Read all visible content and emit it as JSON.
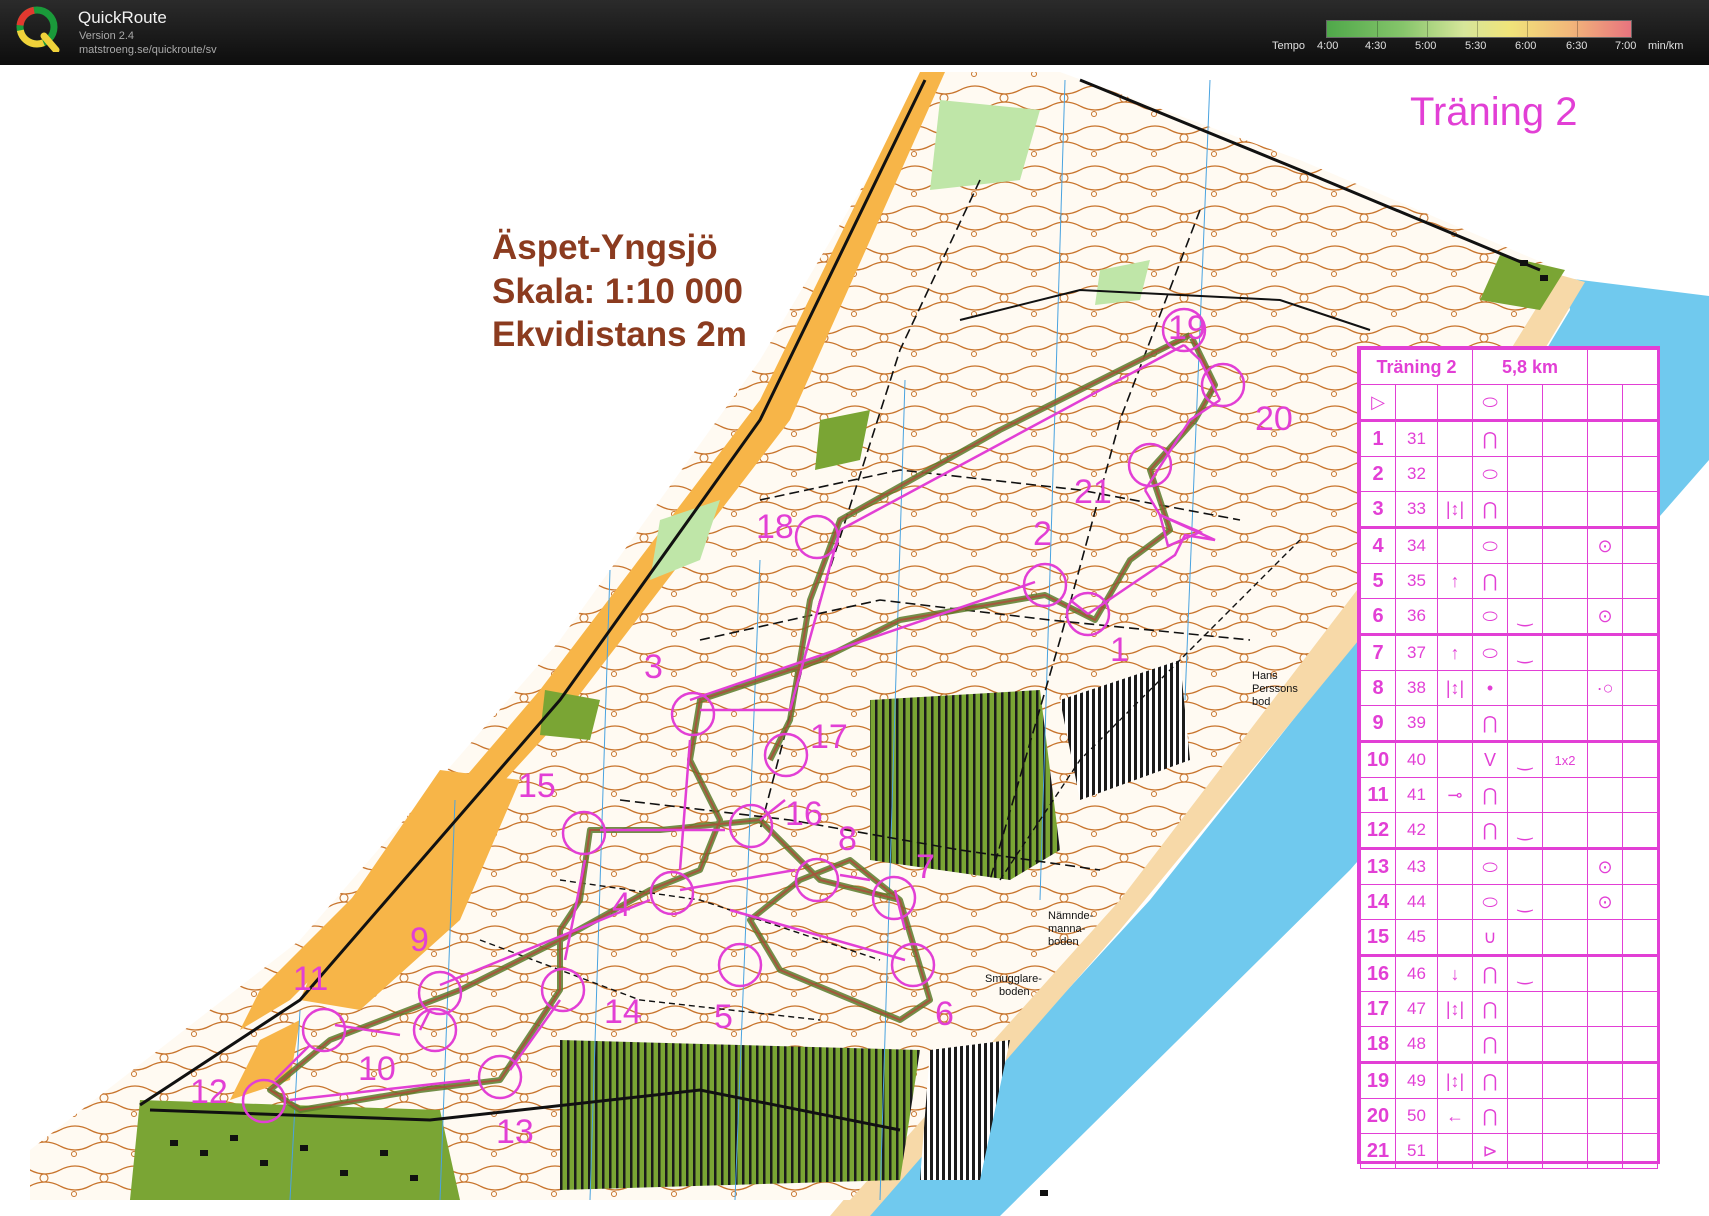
{
  "app": {
    "name": "QuickRoute",
    "version": "Version 2.4",
    "url": "matstroeng.se/quickroute/sv"
  },
  "pace_scale": {
    "label": "Tempo",
    "ticks": [
      "4:00",
      "4:30",
      "5:00",
      "5:30",
      "6:00",
      "6:30",
      "7:00"
    ],
    "unit": "min/km",
    "colors": [
      "#4fa84a",
      "#86c56b",
      "#d6e59a",
      "#f0e47a",
      "#f2b77a",
      "#e8747e"
    ]
  },
  "map": {
    "title_lines": [
      "Äspet-Yngsjö",
      "Skala: 1:10 000",
      "Ekvidistans 2m"
    ],
    "course_title": "Träning 2",
    "colors": {
      "course": "#e23fd5",
      "title": "#8b3b1f",
      "open_land": "#f7b548",
      "forest_green": "#6e8f22",
      "water": "#70c9ee",
      "contour": "#c8742c"
    },
    "controls": [
      {
        "n": "1"
      },
      {
        "n": "2"
      },
      {
        "n": "3"
      },
      {
        "n": "4"
      },
      {
        "n": "5"
      },
      {
        "n": "6"
      },
      {
        "n": "7"
      },
      {
        "n": "8"
      },
      {
        "n": "9"
      },
      {
        "n": "10"
      },
      {
        "n": "11"
      },
      {
        "n": "12"
      },
      {
        "n": "13"
      },
      {
        "n": "14"
      },
      {
        "n": "15"
      },
      {
        "n": "16"
      },
      {
        "n": "17"
      },
      {
        "n": "18"
      },
      {
        "n": "19"
      },
      {
        "n": "20"
      },
      {
        "n": "21"
      }
    ],
    "place_labels": {
      "hans": [
        "Hans",
        "Perssons",
        "bod"
      ],
      "namnde": [
        "Nämnde-",
        "manna-",
        "boden"
      ],
      "smugglare": [
        "Smugglare-",
        "boden"
      ]
    }
  },
  "description_sheet": {
    "header": {
      "course": "Träning 2",
      "length": "5,8 km"
    },
    "start_symbol": "▷",
    "start_feature": "⬭",
    "rows": [
      {
        "n": "1",
        "code": "31",
        "c": "",
        "d": "⋂",
        "e": "",
        "f": "",
        "g": ""
      },
      {
        "n": "2",
        "code": "32",
        "c": "",
        "d": "⬭",
        "e": "",
        "f": "",
        "g": ""
      },
      {
        "n": "3",
        "code": "33",
        "c": "|↕|",
        "d": "⋂",
        "e": "",
        "f": "",
        "g": ""
      },
      {
        "n": "4",
        "code": "34",
        "c": "",
        "d": "⬭",
        "e": "",
        "f": "",
        "g": "⊙"
      },
      {
        "n": "5",
        "code": "35",
        "c": "↑",
        "d": "⋂",
        "e": "",
        "f": "",
        "g": ""
      },
      {
        "n": "6",
        "code": "36",
        "c": "",
        "d": "⬭",
        "e": "‿",
        "f": "",
        "g": "⊙"
      },
      {
        "n": "7",
        "code": "37",
        "c": "↑",
        "d": "⬭",
        "e": "‿",
        "f": "",
        "g": ""
      },
      {
        "n": "8",
        "code": "38",
        "c": "|↕|",
        "d": "•",
        "e": "",
        "f": "",
        "g": "·○"
      },
      {
        "n": "9",
        "code": "39",
        "c": "",
        "d": "⋂",
        "e": "",
        "f": "",
        "g": ""
      },
      {
        "n": "10",
        "code": "40",
        "c": "",
        "d": "V",
        "e": "‿",
        "f": "1x2",
        "g": ""
      },
      {
        "n": "11",
        "code": "41",
        "c": "⊸",
        "d": "⋂",
        "e": "",
        "f": "",
        "g": ""
      },
      {
        "n": "12",
        "code": "42",
        "c": "",
        "d": "⋂",
        "e": "‿",
        "f": "",
        "g": ""
      },
      {
        "n": "13",
        "code": "43",
        "c": "",
        "d": "⬭",
        "e": "",
        "f": "",
        "g": "⊙"
      },
      {
        "n": "14",
        "code": "44",
        "c": "",
        "d": "⬭",
        "e": "‿",
        "f": "",
        "g": "⊙"
      },
      {
        "n": "15",
        "code": "45",
        "c": "",
        "d": "∪",
        "e": "",
        "f": "",
        "g": ""
      },
      {
        "n": "16",
        "code": "46",
        "c": "↓",
        "d": "⋂",
        "e": "‿",
        "f": "",
        "g": ""
      },
      {
        "n": "17",
        "code": "47",
        "c": "|↕|",
        "d": "⋂",
        "e": "",
        "f": "",
        "g": ""
      },
      {
        "n": "18",
        "code": "48",
        "c": "",
        "d": "⋂",
        "e": "",
        "f": "",
        "g": ""
      },
      {
        "n": "19",
        "code": "49",
        "c": "|↕|",
        "d": "⋂",
        "e": "",
        "f": "",
        "g": ""
      },
      {
        "n": "20",
        "code": "50",
        "c": "←",
        "d": "⋂",
        "e": "",
        "f": "",
        "g": ""
      },
      {
        "n": "21",
        "code": "51",
        "c": "",
        "d": "⊳",
        "e": "",
        "f": "",
        "g": ""
      }
    ]
  }
}
